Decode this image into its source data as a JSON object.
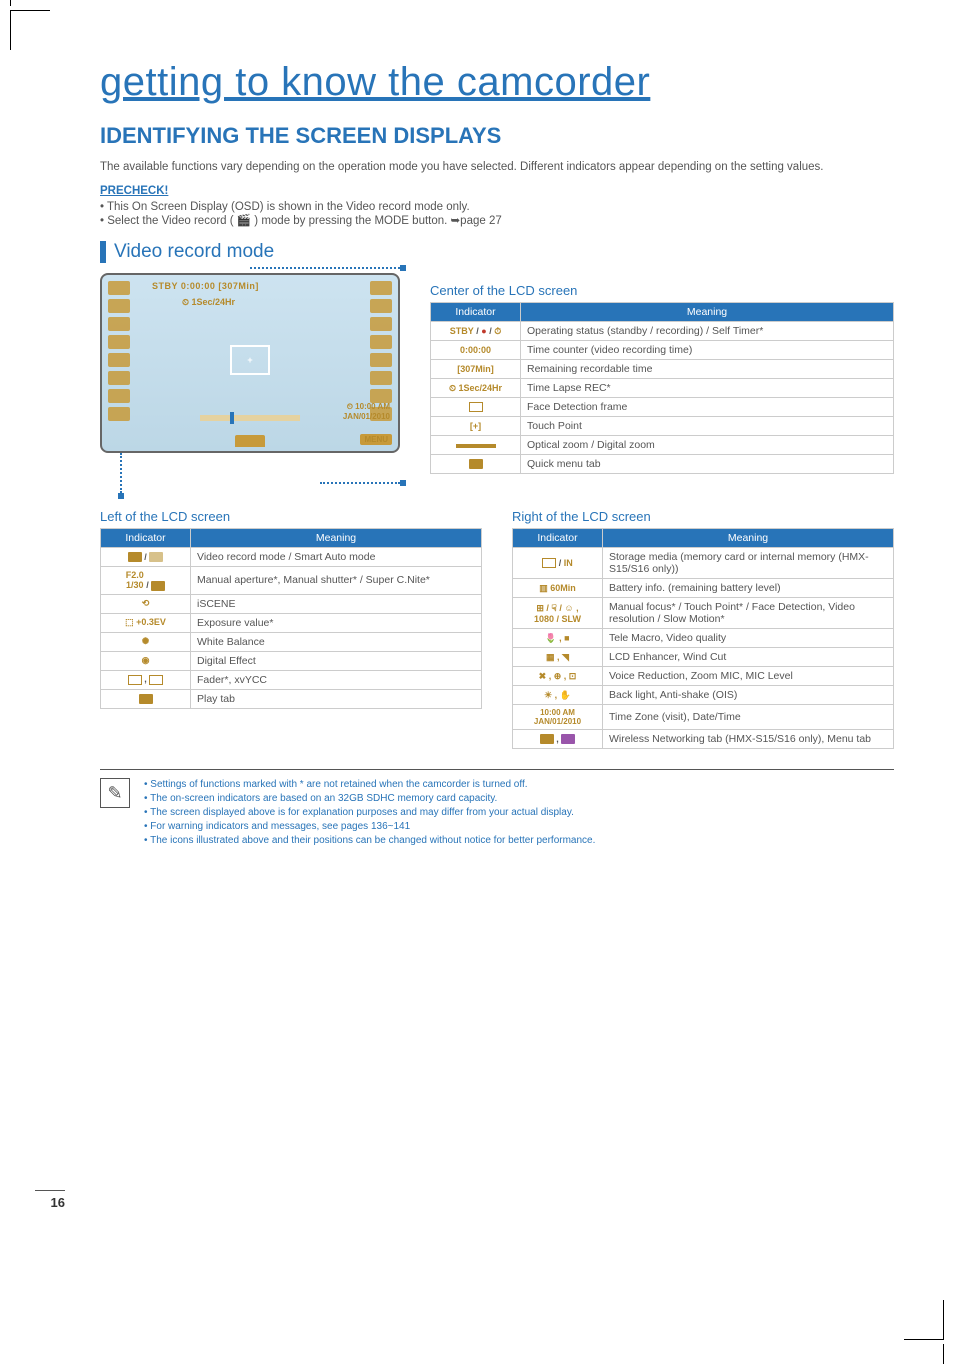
{
  "page_number": "16",
  "chapter_title": "getting to know the camcorder",
  "section_title": "IDENTIFYING THE SCREEN DISPLAYS",
  "intro": "The available functions vary depending on the operation mode you have selected. Different indicators appear depending on the setting values.",
  "precheck_label": "PRECHECK!",
  "precheck_items": [
    "This On Screen Display (OSD) is shown in the Video record mode only.",
    "Select the Video record ( 🎬 ) mode by pressing the MODE button. ➥page 27"
  ],
  "subsection": "Video record mode",
  "lcd": {
    "top1": "STBY 0:00:00 [307Min]",
    "top2": "1Sec/24Hr",
    "bottom_time1": "10:00 AM",
    "bottom_time2": "JAN/01/2010",
    "menu": "MENU"
  },
  "center_heading": "Center of the LCD screen",
  "left_heading": "Left of the LCD screen",
  "right_heading": "Right of the LCD screen",
  "table_headers": {
    "indicator": "Indicator",
    "meaning": "Meaning"
  },
  "center_table": [
    {
      "icon_html": "<span class='ind-icon-orange'>STBY</span> / <span class='ind-icon-red'>●</span> / <span class='ind-icon-orange'>⏱</span>",
      "meaning": "Operating status (standby / recording) / Self Timer*"
    },
    {
      "icon_html": "<span class='ind-icon-orange'>0:00:00</span>",
      "meaning": "Time counter (video recording time)"
    },
    {
      "icon_html": "<span class='ind-icon-orange'>[307Min]</span>",
      "meaning": "Remaining recordable time"
    },
    {
      "icon_html": "<span class='ind-icon-orange'>⏲ 1Sec/24Hr</span>",
      "meaning": "Time Lapse REC*"
    },
    {
      "icon_html": "<span class='icon-box-outline'></span>",
      "meaning": "Face Detection frame"
    },
    {
      "icon_html": "<span class='ind-icon-orange'>[+]</span>",
      "meaning": "Touch Point"
    },
    {
      "icon_html": "<span style='display:inline-block;width:40px;height:4px;background:#b58a2b'></span>",
      "meaning": "Optical zoom / Digital zoom"
    },
    {
      "icon_html": "<span class='icon-box'></span>",
      "meaning": "Quick menu tab"
    }
  ],
  "left_table": [
    {
      "icon_html": "<span class='icon-box'></span> / <span class='icon-box' style='background:#d7c18a'></span>",
      "meaning": "Video record mode / Smart Auto mode"
    },
    {
      "icon_html": "<span class='ind-icon-orange'>F2.0<br>1/30</span> / <span class='icon-box'></span>",
      "meaning": "Manual aperture*, Manual shutter* / Super C.Nite*"
    },
    {
      "icon_html": "<span class='ind-icon-orange'>⟲</span>",
      "meaning": "iSCENE"
    },
    {
      "icon_html": "<span class='ind-icon-orange'>⬚ +0.3EV</span>",
      "meaning": "Exposure value*"
    },
    {
      "icon_html": "<span class='ind-icon-orange'>✺</span>",
      "meaning": "White Balance"
    },
    {
      "icon_html": "<span class='ind-icon-orange'>◉</span>",
      "meaning": "Digital Effect"
    },
    {
      "icon_html": "<span class='icon-box-outline'></span> , <span class='icon-box-outline'></span>",
      "meaning": "Fader*, xvYCC"
    },
    {
      "icon_html": "<span class='icon-box'></span>",
      "meaning": "Play tab"
    }
  ],
  "right_table": [
    {
      "icon_html": "<span class='icon-box-outline'></span> / <span class='ind-icon-orange'>IN</span>",
      "meaning": "Storage media (memory card or internal memory (HMX-S15/S16 only))"
    },
    {
      "icon_html": "<span class='ind-icon-orange'>▥ 60Min</span>",
      "meaning": "Battery info. (remaining battery level)"
    },
    {
      "icon_html": "<span class='ind-icon-orange'>⊞ / ☟ / ☺ ,<br>1080 / SLW</span>",
      "meaning": "Manual focus* / Touch Point* / Face Detection, Video resolution / Slow Motion*"
    },
    {
      "icon_html": "<span class='ind-icon-orange'>🌷 , ■</span>",
      "meaning": "Tele Macro, Video quality"
    },
    {
      "icon_html": "<span class='ind-icon-orange'>▦ , ◥</span>",
      "meaning": "LCD Enhancer, Wind Cut"
    },
    {
      "icon_html": "<span class='ind-icon-orange'>✖ , ⊕ , ⊡</span>",
      "meaning": "Voice Reduction, Zoom MIC, MIC Level"
    },
    {
      "icon_html": "<span class='ind-icon-orange'>☀ , ✋</span>",
      "meaning": "Back light, Anti-shake (OIS)"
    },
    {
      "icon_html": "<span class='ind-icon-orange' style='font-size:8px'>10:00 AM<br>JAN/01/2010</span>",
      "meaning": "Time Zone (visit), Date/Time"
    },
    {
      "icon_html": "<span class='icon-box'></span> , <span class='icon-box' style='background:#95a'></span>",
      "meaning": "Wireless Networking tab (HMX-S15/S16 only), Menu tab"
    }
  ],
  "notes": [
    "Settings of functions marked with * are not retained when the camcorder is turned off.",
    "The on-screen indicators are based on an 32GB SDHC memory card capacity.",
    "The screen displayed above is for explanation purposes and may differ from your actual display.",
    "For warning indicators and messages, see pages 136~141",
    "The icons illustrated above and their positions can be changed without notice for better performance."
  ]
}
